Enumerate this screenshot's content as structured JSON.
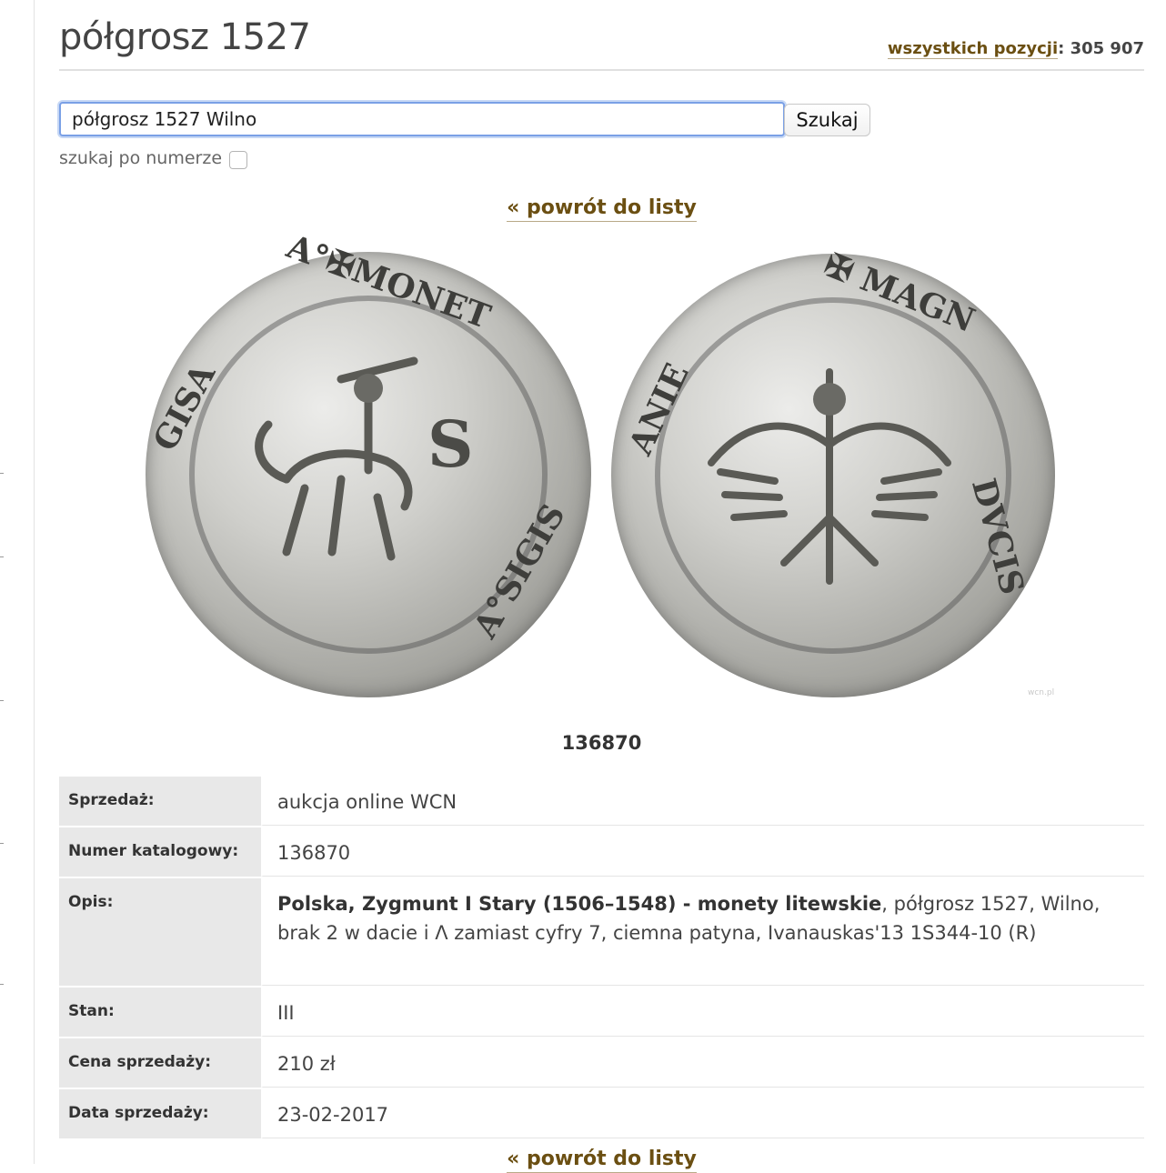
{
  "header": {
    "title": "półgrosz 1527",
    "total_label": "wszystkich pozycji",
    "total_sep": ": ",
    "total_value": "305 907"
  },
  "search": {
    "value": "półgrosz 1527 Wilno",
    "button_label": "Szukaj",
    "by_number_label": "szukaj po numerze"
  },
  "nav": {
    "back_label": "« powrót do listy"
  },
  "coin": {
    "obverse_legend_top": "A°✠MONET",
    "obverse_letter": "S",
    "obverse_legend_left": "GISA",
    "obverse_legend_right": "A°SIGIS",
    "reverse_legend_top": "✠ MAGN",
    "reverse_legend_left": "ANIE",
    "reverse_legend_right": "DVCIS",
    "watermark": "wcn.pl"
  },
  "lot": {
    "number": "136870"
  },
  "details": [
    {
      "label": "Sprzedaż:",
      "value": "aukcja online WCN"
    },
    {
      "label": "Numer katalogowy:",
      "value": "136870"
    },
    {
      "label": "Opis:",
      "value_bold": "Polska, Zygmunt I Stary (1506–1548) - monety litewskie",
      "value": ", półgrosz 1527, Wilno, brak 2 w dacie i Λ zamiast cyfry 7, ciemna patyna, Ivanauskas'13 1S344-10 (R)"
    },
    {
      "label": "Stan:",
      "value": "III"
    },
    {
      "label": "Cena sprzedaży:",
      "value": "210 zł"
    },
    {
      "label": "Data sprzedaży:",
      "value": "23-02-2017"
    }
  ]
}
